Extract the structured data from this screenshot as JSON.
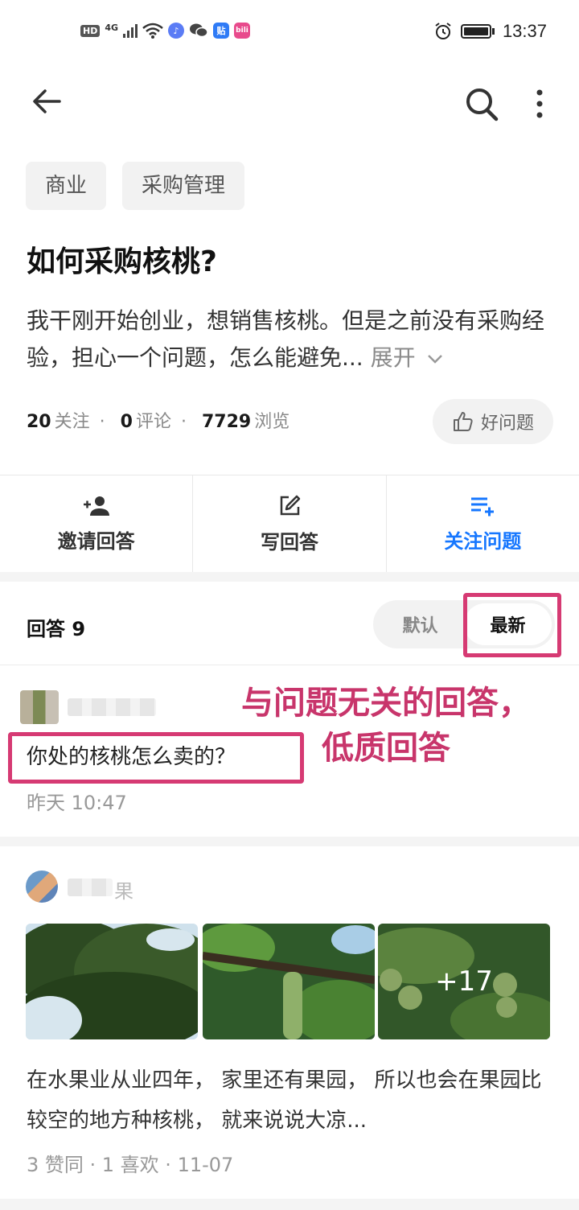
{
  "status_bar": {
    "hd": "HD",
    "network": "4G",
    "app1": "贴",
    "app2": "bili",
    "time": "13:37"
  },
  "tags": [
    "商业",
    "采购管理"
  ],
  "question": {
    "title": "如何采购核桃?",
    "description": "我干刚开始创业，想销售核桃。但是之前没有采购经验，担心一个问题，怎么能避免...",
    "expand_label": "展开"
  },
  "stats": {
    "follow_count": "20",
    "follow_label": "关注",
    "comment_count": "0",
    "comment_label": "评论",
    "view_count": "7729",
    "view_label": "浏览"
  },
  "good_question_label": "好问题",
  "actions": {
    "invite": "邀请回答",
    "write": "写回答",
    "follow": "关注问题"
  },
  "answers_header": "回答 9",
  "sort": {
    "default": "默认",
    "latest": "最新",
    "active": "latest"
  },
  "annotation": {
    "line1": "与问题无关的回答，",
    "line2": "低质回答"
  },
  "answer1": {
    "text": "你处的核桃怎么卖的？",
    "time": "昨天 10:47"
  },
  "answer2": {
    "name_suffix": "果",
    "more_images": "+17",
    "text": "在水果业从业四年， 家里还有果园， 所以也会在果园比较空的地方种核桃， 就来说说大凉...",
    "meta": "3 赞同 · 1 喜欢 · 11-07"
  },
  "colors": {
    "accent": "#1677ff",
    "annotation": "#d63a73"
  }
}
